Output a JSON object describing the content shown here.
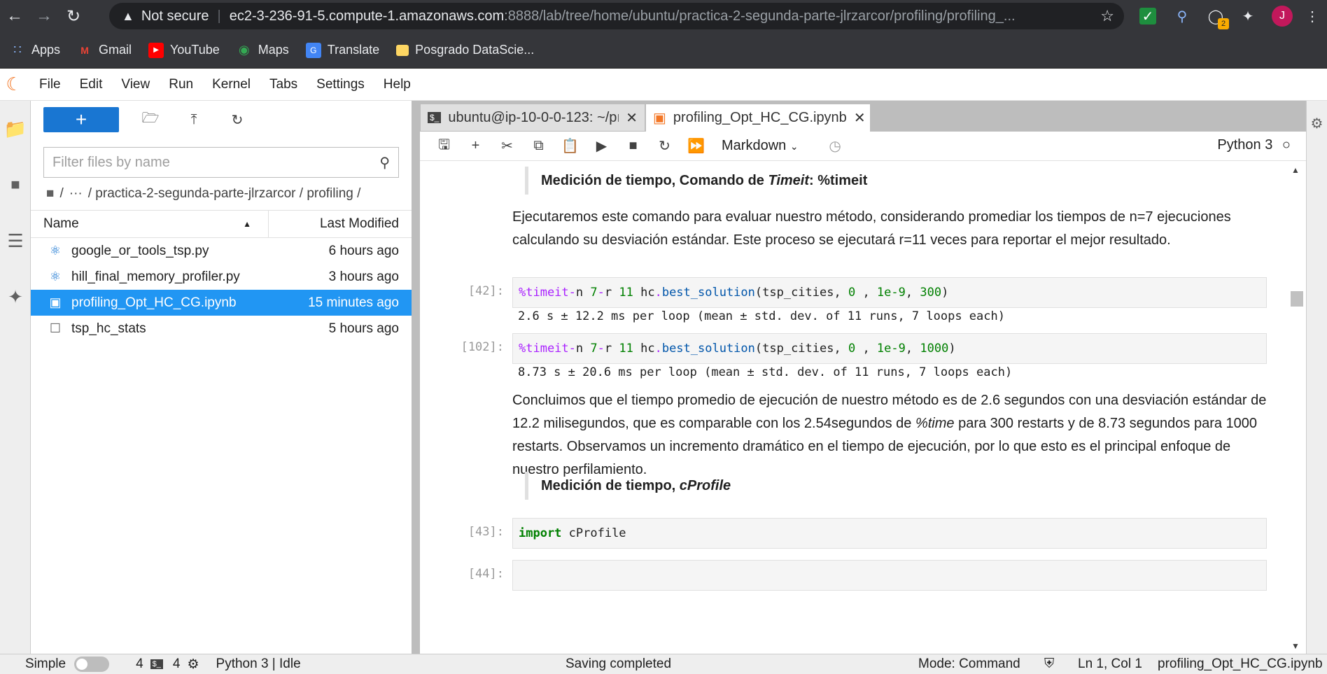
{
  "browser": {
    "not_secure": "Not secure",
    "url_host": "ec2-3-236-91-5.compute-1.amazonaws.com",
    "url_rest": ":8888/lab/tree/home/ubuntu/practica-2-segunda-parte-jlrzarcor/profiling/profiling_...",
    "profile_initial": "J",
    "ext_badge": "2",
    "bookmarks": [
      "Apps",
      "Gmail",
      "YouTube",
      "Maps",
      "Translate",
      "Posgrado DataScie..."
    ]
  },
  "menu": [
    "File",
    "Edit",
    "View",
    "Run",
    "Kernel",
    "Tabs",
    "Settings",
    "Help"
  ],
  "filebrowser": {
    "new_label": "+",
    "filter_placeholder": "Filter files by name",
    "crumb_root": "/",
    "crumb_ellipsis": "···",
    "crumb_path": "/ practica-2-segunda-parte-jlrzarcor / profiling /",
    "col_name": "Name",
    "col_modified": "Last Modified",
    "files": [
      {
        "name": "google_or_tools_tsp.py",
        "modified": "6 hours ago"
      },
      {
        "name": "hill_final_memory_profiler.py",
        "modified": "3 hours ago"
      },
      {
        "name": "profiling_Opt_HC_CG.ipynb",
        "modified": "15 minutes ago"
      },
      {
        "name": "tsp_hc_stats",
        "modified": "5 hours ago"
      }
    ]
  },
  "tabs": [
    {
      "label": "ubuntu@ip-10-0-0-123: ~/pı"
    },
    {
      "label": "profiling_Opt_HC_CG.ipynb"
    }
  ],
  "toolbar": {
    "cell_type": "Markdown",
    "kernel": "Python 3"
  },
  "cells": {
    "h1": "Medición de tiempo, Comando de ",
    "h1_em": "Timeit",
    "h1_tail": ": %timeit",
    "p1": "Ejecutaremos este comando para evaluar nuestro método, considerando promediar los tiempos de n=7 ejecuciones calculando su desviación estándar. Este proceso se ejecutará r=11 veces para reportar el mejor resultado.",
    "prompt1": "[42]:",
    "out1": "2.6 s ± 12.2 ms per loop (mean ± std. dev. of 11 runs, 7 loops each)",
    "prompt2": "[102]:",
    "out2": "8.73 s ± 20.6 ms per loop (mean ± std. dev. of 11 runs, 7 loops each)",
    "p2a": "Concluimos que el tiempo promedio de ejecución de nuestro método es de 2.6 segundos con una desviación estándar de 12.2 milisegundos, que es comparable con los 2.54segundos de ",
    "p2_em": "%time",
    "p2b": " para 300 restarts y de 8.73 segundos para 1000 restarts. Observamos un incremento dramático en el tiempo de ejecución, por lo que esto es el principal enfoque de nuestro perfilamiento.",
    "h2": "Medición de tiempo, ",
    "h2_em": "cProfile",
    "prompt3": "[43]:",
    "code3_kw": "import",
    "code3_rest": " cProfile",
    "prompt4": "[44]:"
  },
  "status": {
    "mode_simple": "Simple",
    "count1": "4",
    "count2": "4",
    "kernel_state": "Python 3 | Idle",
    "saving": "Saving completed",
    "mode": "Mode: Command",
    "cursor": "Ln 1, Col 1",
    "file": "profiling_Opt_HC_CG.ipynb"
  }
}
